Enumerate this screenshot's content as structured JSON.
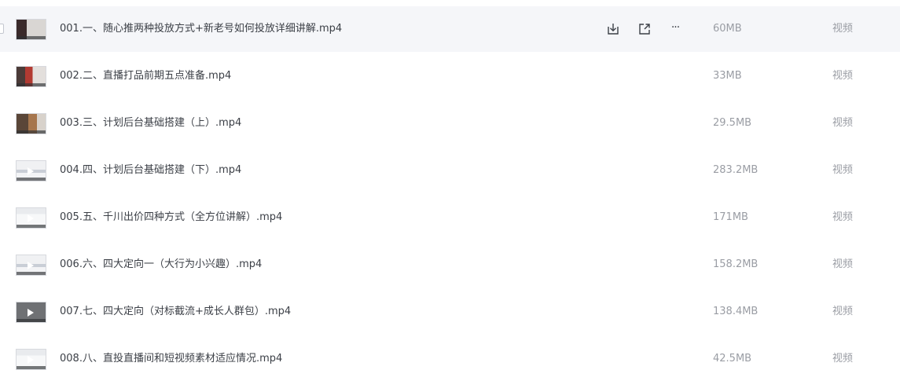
{
  "files": [
    {
      "name": "001.一、随心推两种投放方式+新老号如何投放详细讲解.mp4",
      "size": "60MB",
      "type": "视频",
      "thumb": "t-dark",
      "hover": true
    },
    {
      "name": "002.二、直播打品前期五点准备.mp4",
      "size": "33MB",
      "type": "视频",
      "thumb": "t-red",
      "hover": false
    },
    {
      "name": "003.三、计划后台基础搭建（上）.mp4",
      "size": "29.5MB",
      "type": "视频",
      "thumb": "t-photo",
      "hover": false
    },
    {
      "name": "004.四、计划后台基础搭建（下）.mp4",
      "size": "283.2MB",
      "type": "视频",
      "thumb": "t-ui",
      "hover": false
    },
    {
      "name": "005.五、千川出价四种方式（全方位讲解）.mp4",
      "size": "171MB",
      "type": "视频",
      "thumb": "t-light",
      "hover": false
    },
    {
      "name": "006.六、四大定向一（大行为小兴趣）.mp4",
      "size": "158.2MB",
      "type": "视频",
      "thumb": "t-ui",
      "hover": false
    },
    {
      "name": "007.七、四大定向（对标截流+成长人群包）.mp4",
      "size": "138.4MB",
      "type": "视频",
      "thumb": "t-gray",
      "hover": false
    },
    {
      "name": "008.八、直投直播间和短视频素材适应情况.mp4",
      "size": "42.5MB",
      "type": "视频",
      "thumb": "t-light",
      "hover": false
    }
  ],
  "row_actions": {
    "icons": [
      "download-icon",
      "share-icon",
      "more-icon"
    ],
    "more_glyph": "···"
  },
  "colors": {
    "hover_row": "#f5f6f9",
    "text": "#3b3f46",
    "muted": "#9a9da4"
  }
}
